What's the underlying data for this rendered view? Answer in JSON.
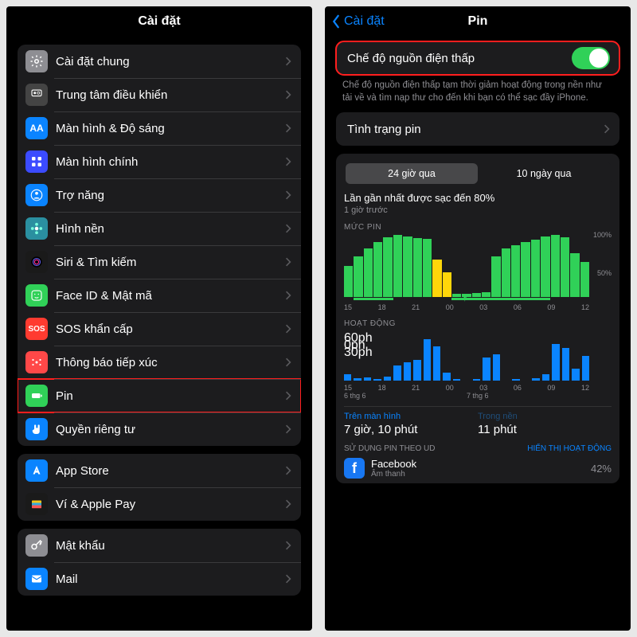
{
  "left": {
    "title": "Cài đặt",
    "items": [
      {
        "id": "general",
        "label": "Cài đặt chung",
        "bg": "#8e8e93",
        "glyph": "gear"
      },
      {
        "id": "control",
        "label": "Trung tâm điều khiển",
        "bg": "#444",
        "glyph": "ctrl"
      },
      {
        "id": "display",
        "label": "Màn hình & Độ sáng",
        "bg": "#0a84ff",
        "glyph": "AA"
      },
      {
        "id": "home",
        "label": "Màn hình chính",
        "bg": "#3b4bff",
        "glyph": "grid"
      },
      {
        "id": "access",
        "label": "Trợ năng",
        "bg": "#0a84ff",
        "glyph": "person"
      },
      {
        "id": "wallpaper",
        "label": "Hình nền",
        "bg": "#2a8fa0",
        "glyph": "flower"
      },
      {
        "id": "siri",
        "label": "Siri & Tìm kiếm",
        "bg": "#1a1a1a",
        "glyph": "siri"
      },
      {
        "id": "faceid",
        "label": "Face ID & Mật mã",
        "bg": "#30d158",
        "glyph": "face"
      },
      {
        "id": "sos",
        "label": "SOS khẩn cấp",
        "bg": "#ff3b30",
        "glyph": "SOS"
      },
      {
        "id": "exposure",
        "label": "Thông báo tiếp xúc",
        "bg": "#ff4848",
        "glyph": "dots"
      },
      {
        "id": "battery",
        "label": "Pin",
        "bg": "#30d158",
        "glyph": "batt",
        "hl": true
      },
      {
        "id": "privacy",
        "label": "Quyền riêng tư",
        "bg": "#0a84ff",
        "glyph": "hand"
      }
    ],
    "items2": [
      {
        "id": "appstore",
        "label": "App Store",
        "bg": "#0a84ff",
        "glyph": "A"
      },
      {
        "id": "wallet",
        "label": "Ví & Apple Pay",
        "bg": "#1a1a1a",
        "glyph": "wallet"
      }
    ],
    "items3": [
      {
        "id": "passwords",
        "label": "Mật khẩu",
        "bg": "#8e8e93",
        "glyph": "key"
      },
      {
        "id": "mail",
        "label": "Mail",
        "bg": "#0a84ff",
        "glyph": "mail"
      }
    ]
  },
  "right": {
    "back": "Cài đặt",
    "title": "Pin",
    "lowpower_label": "Chế độ nguồn điện thấp",
    "lowpower_on": true,
    "desc": "Chế độ nguồn điện thấp tạm thời giảm hoạt động trong nền như tải về và tìm nạp thư cho đến khi bạn có thể sạc đầy iPhone.",
    "health_label": "Tình trạng pin",
    "seg": [
      "24 giờ qua",
      "10 ngày qua"
    ],
    "seg_active": 0,
    "last_charge_title": "Lần gần nhất được sạc đến 80%",
    "last_charge_sub": "1 giờ trước",
    "level_section": "MỨC PIN",
    "activity_section": "HOẠT ĐỘNG",
    "yticks_level": [
      "100%",
      "50%"
    ],
    "xticks": [
      "15",
      "18",
      "21",
      "00",
      "03",
      "06",
      "09",
      "12"
    ],
    "xticks_date": [
      "6 thg 6",
      "7 thg 6"
    ],
    "yticks_act": [
      "60ph",
      "30ph",
      "0ph"
    ],
    "onscreen_label": "Trên màn hình",
    "onscreen_value": "7 giờ, 10 phút",
    "background_label": "Trong nền",
    "background_value": "11 phút",
    "usage_header_left": "SỬ DỤNG PIN THEO UD",
    "usage_header_right": "HIỂN THỊ HOẠT ĐỘNG",
    "usage_app_name": "Facebook",
    "usage_app_sub": "Âm thanh",
    "usage_app_pct": "42%"
  },
  "chart_data": [
    {
      "type": "bar",
      "title": "MỨC PIN",
      "ylabel": "%",
      "ylim": [
        0,
        100
      ],
      "x_hours": [
        13,
        14,
        15,
        16,
        17,
        18,
        19,
        20,
        21,
        22,
        23,
        0,
        1,
        2,
        3,
        4,
        5,
        6,
        7,
        8,
        9,
        10,
        11,
        12,
        13
      ],
      "series": [
        {
          "name": "battery_level_pct",
          "values": [
            50,
            65,
            78,
            88,
            96,
            100,
            98,
            95,
            94,
            60,
            40,
            5,
            5,
            6,
            8,
            66,
            78,
            84,
            88,
            93,
            97,
            100,
            96,
            70,
            56
          ]
        },
        {
          "name": "low_power_mode_on",
          "values": [
            0,
            0,
            0,
            0,
            0,
            0,
            0,
            0,
            0,
            1,
            1,
            0,
            0,
            0,
            0,
            0,
            0,
            0,
            0,
            0,
            0,
            0,
            0,
            0,
            0
          ]
        },
        {
          "name": "charging",
          "values": [
            0,
            1,
            1,
            1,
            1,
            0,
            0,
            0,
            0,
            0,
            0,
            1,
            1,
            1,
            1,
            1,
            1,
            1,
            1,
            1,
            1,
            0,
            0,
            0,
            0
          ]
        }
      ],
      "xticks": [
        "15",
        "18",
        "21",
        "00",
        "03",
        "06",
        "09",
        "12"
      ]
    },
    {
      "type": "bar",
      "title": "HOẠT ĐỘNG",
      "ylabel": "phút",
      "ylim": [
        0,
        60
      ],
      "x_hours": [
        13,
        14,
        15,
        16,
        17,
        18,
        19,
        20,
        21,
        22,
        23,
        0,
        1,
        2,
        3,
        4,
        5,
        6,
        7,
        8,
        9,
        10,
        11,
        12,
        13
      ],
      "series": [
        {
          "name": "screen_on_minutes",
          "values": [
            8,
            3,
            4,
            2,
            5,
            18,
            22,
            25,
            50,
            42,
            10,
            2,
            0,
            2,
            28,
            32,
            0,
            2,
            0,
            3,
            8,
            45,
            40,
            15,
            30
          ]
        }
      ],
      "xticks": [
        "15",
        "18",
        "21",
        "00",
        "03",
        "06",
        "09",
        "12"
      ],
      "date_labels": [
        "6 thg 6",
        "7 thg 6"
      ]
    }
  ]
}
